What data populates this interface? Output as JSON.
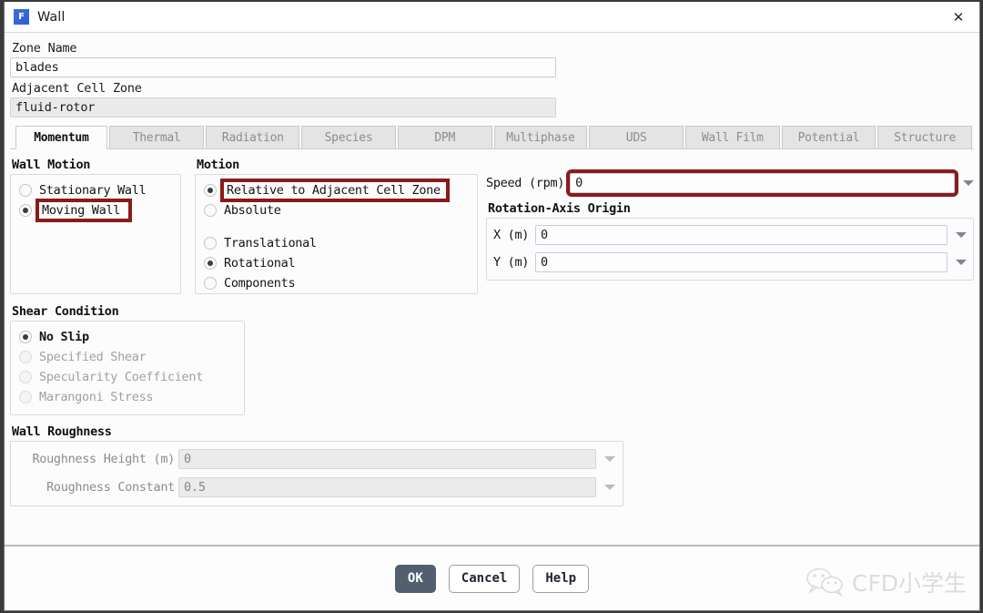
{
  "window": {
    "title": "Wall",
    "app_icon": "fluent-f-icon",
    "close_icon": "close-icon"
  },
  "fields": {
    "zone_name_label": "Zone Name",
    "zone_name_value": "blades",
    "adjacent_cell_zone_label": "Adjacent Cell Zone",
    "adjacent_cell_zone_value": "fluid-rotor"
  },
  "tabs": [
    {
      "label": "Momentum",
      "active": true
    },
    {
      "label": "Thermal",
      "active": false
    },
    {
      "label": "Radiation",
      "active": false
    },
    {
      "label": "Species",
      "active": false
    },
    {
      "label": "DPM",
      "active": false
    },
    {
      "label": "Multiphase",
      "active": false
    },
    {
      "label": "UDS",
      "active": false
    },
    {
      "label": "Wall Film",
      "active": false
    },
    {
      "label": "Potential",
      "active": false
    },
    {
      "label": "Structure",
      "active": false
    }
  ],
  "wall_motion": {
    "title": "Wall Motion",
    "options": [
      {
        "label": "Stationary Wall",
        "selected": false,
        "highlighted": false
      },
      {
        "label": "Moving Wall",
        "selected": true,
        "highlighted": true
      }
    ]
  },
  "motion": {
    "title": "Motion",
    "frame_options": [
      {
        "label": "Relative to Adjacent Cell Zone",
        "selected": true,
        "highlighted": true
      },
      {
        "label": "Absolute",
        "selected": false,
        "highlighted": false
      }
    ],
    "type_options": [
      {
        "label": "Translational",
        "selected": false
      },
      {
        "label": "Rotational",
        "selected": true
      },
      {
        "label": "Components",
        "selected": false
      }
    ]
  },
  "speed": {
    "label": "Speed (rpm)",
    "value": "0",
    "highlighted": true,
    "dropdown_icon": "chevron-down-icon"
  },
  "rotation_axis_origin": {
    "title": "Rotation-Axis Origin",
    "rows": [
      {
        "label": "X (m)",
        "value": "0",
        "dropdown_icon": "chevron-down-icon"
      },
      {
        "label": "Y (m)",
        "value": "0",
        "dropdown_icon": "chevron-down-icon"
      }
    ]
  },
  "shear_condition": {
    "title": "Shear Condition",
    "options": [
      {
        "label": "No Slip",
        "selected": true,
        "disabled": false
      },
      {
        "label": "Specified Shear",
        "selected": false,
        "disabled": true
      },
      {
        "label": "Specularity Coefficient",
        "selected": false,
        "disabled": true
      },
      {
        "label": "Marangoni Stress",
        "selected": false,
        "disabled": true
      }
    ]
  },
  "wall_roughness": {
    "title": "Wall Roughness",
    "rows": [
      {
        "label": "Roughness Height (m)",
        "value": "0",
        "disabled": true,
        "dropdown_icon": "chevron-down-icon"
      },
      {
        "label": "Roughness Constant",
        "value": "0.5",
        "disabled": true,
        "dropdown_icon": "chevron-down-icon"
      }
    ]
  },
  "buttons": {
    "ok": "OK",
    "cancel": "Cancel",
    "help": "Help"
  },
  "watermark": {
    "icon": "wechat-icon",
    "text": "CFD小学生"
  },
  "colors": {
    "annotation_red": "#8b1a1a",
    "primary_button": "#525f6f",
    "app_icon_blue": "#3b6fe0"
  }
}
